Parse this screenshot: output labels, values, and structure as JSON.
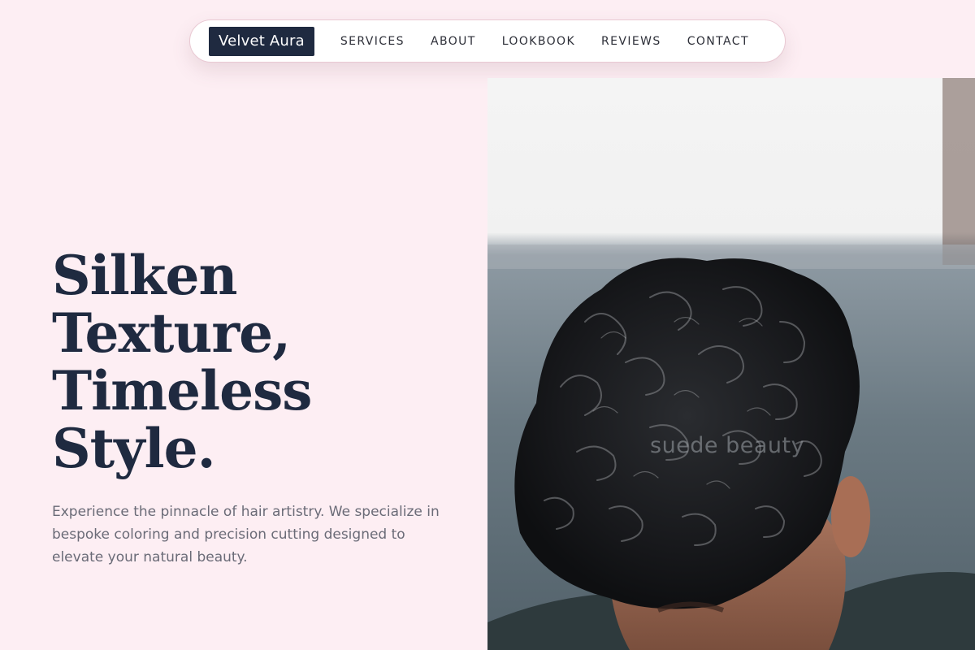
{
  "nav": {
    "brand": "Velvet Aura",
    "links": [
      "SERVICES",
      "ABOUT",
      "LOOKBOOK",
      "REVIEWS",
      "CONTACT"
    ]
  },
  "hero": {
    "title_lines": [
      "Silken",
      "Texture,",
      "Timeless",
      "Style."
    ],
    "description": "Experience the pinnacle of hair artistry. We specialize in bespoke coloring and precision cutting designed to elevate your natural beauty.",
    "image": {
      "subject": "man with dark curly hair looking down",
      "watermark": "suede beauty"
    }
  },
  "colors": {
    "background": "#fdeef3",
    "brand_bg": "#1f2a40",
    "heading": "#1f2a40",
    "body_text": "#6a6b77",
    "nav_text": "#2d2f38"
  }
}
